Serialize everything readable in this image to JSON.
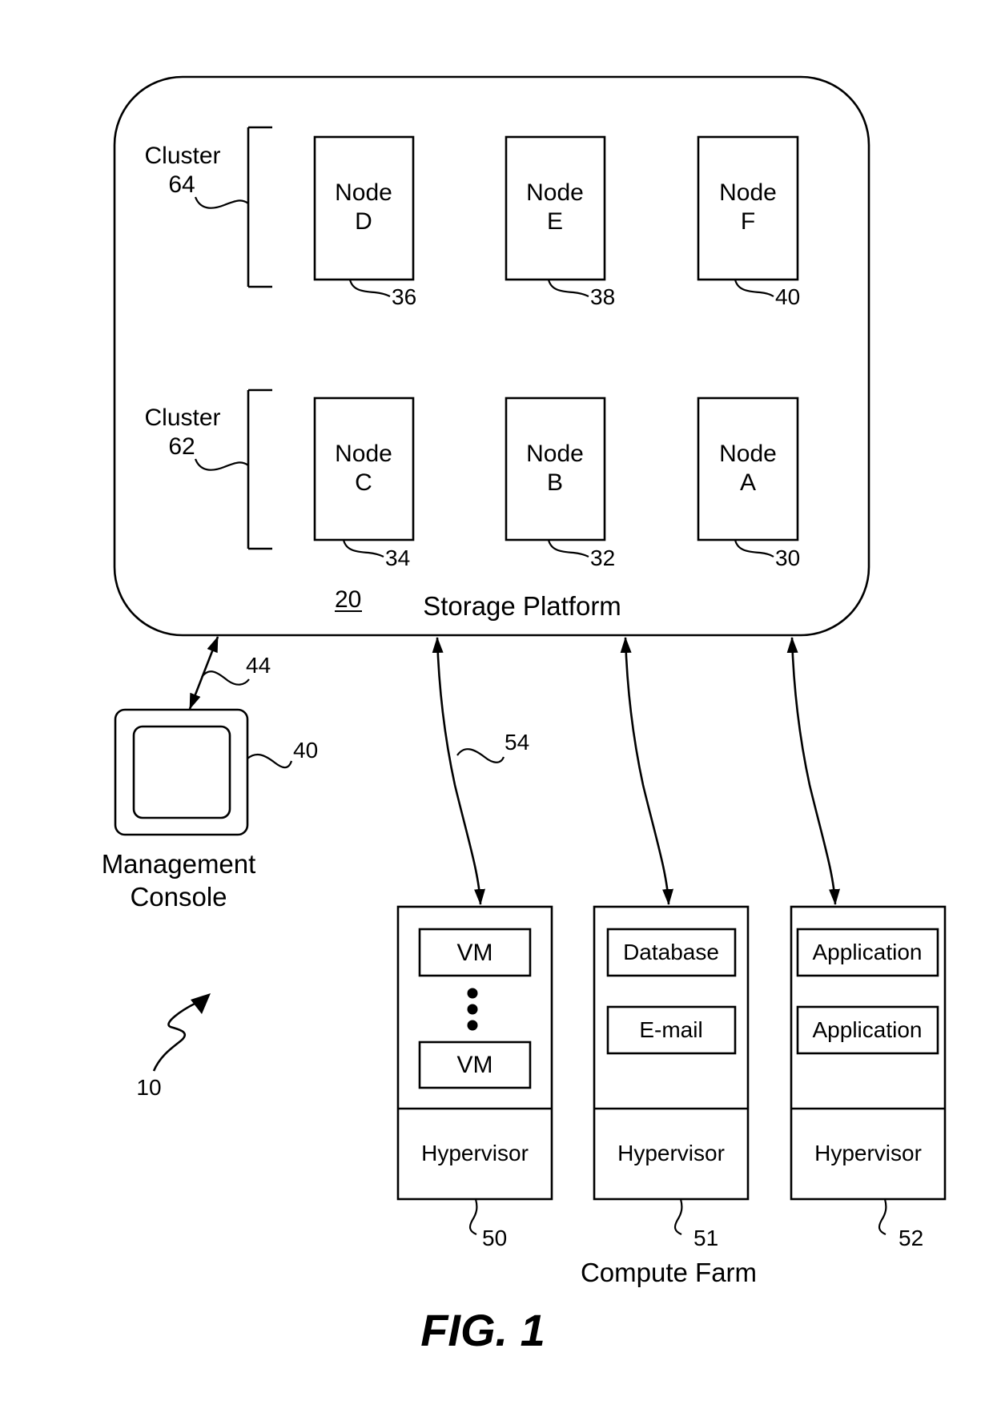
{
  "figure": {
    "caption": "FIG. 1",
    "system_ref": "10"
  },
  "storage_platform": {
    "label": "Storage Platform",
    "ref": "20",
    "clusters": [
      {
        "label": "Cluster",
        "ref": "64",
        "nodes": [
          {
            "label": "Node",
            "letter": "D",
            "ref": "36"
          },
          {
            "label": "Node",
            "letter": "E",
            "ref": "38"
          },
          {
            "label": "Node",
            "letter": "F",
            "ref": "40"
          }
        ]
      },
      {
        "label": "Cluster",
        "ref": "62",
        "nodes": [
          {
            "label": "Node",
            "letter": "C",
            "ref": "34"
          },
          {
            "label": "Node",
            "letter": "B",
            "ref": "32"
          },
          {
            "label": "Node",
            "letter": "A",
            "ref": "30"
          }
        ]
      }
    ]
  },
  "management_console": {
    "label_line1": "Management",
    "label_line2": "Console",
    "ref": "40",
    "link_ref": "44"
  },
  "compute_farm": {
    "label": "Compute Farm",
    "link_ref": "54",
    "servers": [
      {
        "ref": "50",
        "items": [
          "VM",
          "VM"
        ],
        "ellipsis": true,
        "hypervisor": "Hypervisor"
      },
      {
        "ref": "51",
        "items": [
          "Database",
          "E-mail"
        ],
        "ellipsis": false,
        "hypervisor": "Hypervisor"
      },
      {
        "ref": "52",
        "items": [
          "Application",
          "Application"
        ],
        "ellipsis": false,
        "hypervisor": "Hypervisor"
      }
    ]
  }
}
